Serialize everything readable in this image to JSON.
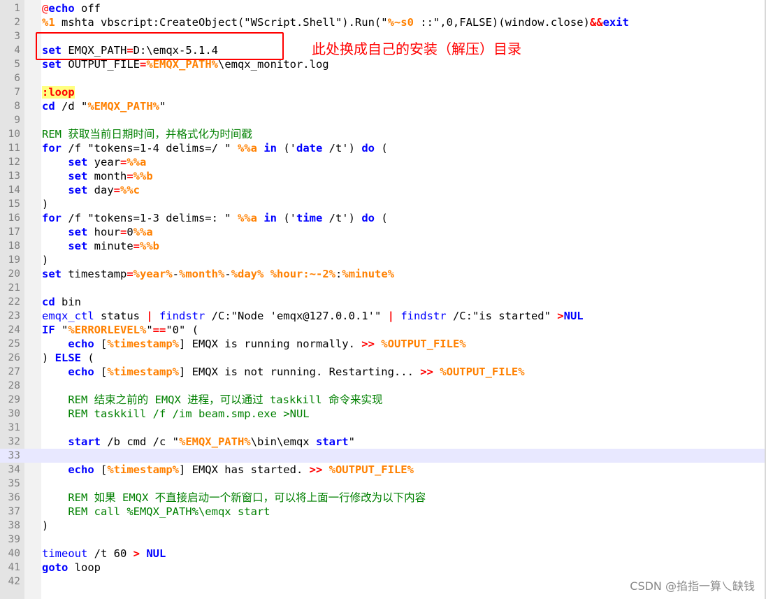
{
  "editor": {
    "current_line": 33,
    "lines": [
      {
        "n": "1",
        "tokens": [
          {
            "t": "@",
            "c": "at"
          },
          {
            "t": "echo",
            "c": "kw"
          },
          {
            "t": " off",
            "c": ""
          }
        ]
      },
      {
        "n": "2",
        "tokens": [
          {
            "t": "%1",
            "c": "var"
          },
          {
            "t": " mshta vbscript:CreateObject(\"WScript.Shell\").Run(\"",
            "c": ""
          },
          {
            "t": "%~s0",
            "c": "var"
          },
          {
            "t": " ::\",0,FALSE)(window.close)",
            "c": ""
          },
          {
            "t": "&&",
            "c": "op"
          },
          {
            "t": "exit",
            "c": "kw"
          }
        ]
      },
      {
        "n": "3",
        "tokens": []
      },
      {
        "n": "4",
        "tokens": [
          {
            "t": "set",
            "c": "kw"
          },
          {
            "t": " EMQX_PATH",
            "c": ""
          },
          {
            "t": "=",
            "c": "op"
          },
          {
            "t": "D:\\emqx-5.1.4",
            "c": ""
          }
        ]
      },
      {
        "n": "5",
        "tokens": [
          {
            "t": "set",
            "c": "kw"
          },
          {
            "t": " OUTPUT_FILE",
            "c": ""
          },
          {
            "t": "=",
            "c": "op"
          },
          {
            "t": "%EMQX_PATH%",
            "c": "var"
          },
          {
            "t": "\\emqx_monitor.log",
            "c": ""
          }
        ]
      },
      {
        "n": "6",
        "tokens": []
      },
      {
        "n": "7",
        "tokens": [
          {
            "t": ":loop",
            "c": "lbl"
          }
        ]
      },
      {
        "n": "8",
        "tokens": [
          {
            "t": "cd",
            "c": "kw"
          },
          {
            "t": " /d \"",
            "c": ""
          },
          {
            "t": "%EMQX_PATH%",
            "c": "var"
          },
          {
            "t": "\"",
            "c": ""
          }
        ]
      },
      {
        "n": "9",
        "tokens": []
      },
      {
        "n": "10",
        "tokens": [
          {
            "t": "REM 获取当前日期时间，并格式化为时间戳",
            "c": "cmt"
          }
        ]
      },
      {
        "n": "11",
        "tokens": [
          {
            "t": "for",
            "c": "kw"
          },
          {
            "t": " /f \"tokens=1-4 delims=/ \" ",
            "c": ""
          },
          {
            "t": "%%a",
            "c": "var"
          },
          {
            "t": " ",
            "c": ""
          },
          {
            "t": "in",
            "c": "kw"
          },
          {
            "t": " ('",
            "c": ""
          },
          {
            "t": "date",
            "c": "kw"
          },
          {
            "t": " /t') ",
            "c": ""
          },
          {
            "t": "do",
            "c": "kw"
          },
          {
            "t": " (",
            "c": ""
          }
        ]
      },
      {
        "n": "12",
        "tokens": [
          {
            "t": "    ",
            "c": ""
          },
          {
            "t": "set",
            "c": "kw"
          },
          {
            "t": " year",
            "c": ""
          },
          {
            "t": "=",
            "c": "op"
          },
          {
            "t": "%%a",
            "c": "var"
          }
        ]
      },
      {
        "n": "13",
        "tokens": [
          {
            "t": "    ",
            "c": ""
          },
          {
            "t": "set",
            "c": "kw"
          },
          {
            "t": " month",
            "c": ""
          },
          {
            "t": "=",
            "c": "op"
          },
          {
            "t": "%%b",
            "c": "var"
          }
        ]
      },
      {
        "n": "14",
        "tokens": [
          {
            "t": "    ",
            "c": ""
          },
          {
            "t": "set",
            "c": "kw"
          },
          {
            "t": " day",
            "c": ""
          },
          {
            "t": "=",
            "c": "op"
          },
          {
            "t": "%%c",
            "c": "var"
          }
        ]
      },
      {
        "n": "15",
        "tokens": [
          {
            "t": ")",
            "c": ""
          }
        ]
      },
      {
        "n": "16",
        "tokens": [
          {
            "t": "for",
            "c": "kw"
          },
          {
            "t": " /f \"tokens=1-3 delims=: \" ",
            "c": ""
          },
          {
            "t": "%%a",
            "c": "var"
          },
          {
            "t": " ",
            "c": ""
          },
          {
            "t": "in",
            "c": "kw"
          },
          {
            "t": " ('",
            "c": ""
          },
          {
            "t": "time",
            "c": "kw"
          },
          {
            "t": " /t') ",
            "c": ""
          },
          {
            "t": "do",
            "c": "kw"
          },
          {
            "t": " (",
            "c": ""
          }
        ]
      },
      {
        "n": "17",
        "tokens": [
          {
            "t": "    ",
            "c": ""
          },
          {
            "t": "set",
            "c": "kw"
          },
          {
            "t": " hour",
            "c": ""
          },
          {
            "t": "=",
            "c": "op"
          },
          {
            "t": "0",
            "c": ""
          },
          {
            "t": "%%a",
            "c": "var"
          }
        ]
      },
      {
        "n": "18",
        "tokens": [
          {
            "t": "    ",
            "c": ""
          },
          {
            "t": "set",
            "c": "kw"
          },
          {
            "t": " minute",
            "c": ""
          },
          {
            "t": "=",
            "c": "op"
          },
          {
            "t": "%%b",
            "c": "var"
          }
        ]
      },
      {
        "n": "19",
        "tokens": [
          {
            "t": ")",
            "c": ""
          }
        ]
      },
      {
        "n": "20",
        "tokens": [
          {
            "t": "set",
            "c": "kw"
          },
          {
            "t": " timestamp",
            "c": ""
          },
          {
            "t": "=",
            "c": "op"
          },
          {
            "t": "%year%",
            "c": "var"
          },
          {
            "t": "-",
            "c": ""
          },
          {
            "t": "%month%",
            "c": "var"
          },
          {
            "t": "-",
            "c": ""
          },
          {
            "t": "%day%",
            "c": "var"
          },
          {
            "t": " ",
            "c": ""
          },
          {
            "t": "%hour:~-2%",
            "c": "var"
          },
          {
            "t": ":",
            "c": ""
          },
          {
            "t": "%minute%",
            "c": "var"
          }
        ]
      },
      {
        "n": "21",
        "tokens": []
      },
      {
        "n": "22",
        "tokens": [
          {
            "t": "cd",
            "c": "kw"
          },
          {
            "t": " bin",
            "c": ""
          }
        ]
      },
      {
        "n": "23",
        "tokens": [
          {
            "t": "emqx_ctl",
            "c": "cmd"
          },
          {
            "t": " status ",
            "c": ""
          },
          {
            "t": "|",
            "c": "op"
          },
          {
            "t": " ",
            "c": ""
          },
          {
            "t": "findstr",
            "c": "cmd"
          },
          {
            "t": " /C:\"Node 'emqx@127.0.0.1'\" ",
            "c": ""
          },
          {
            "t": "|",
            "c": "op"
          },
          {
            "t": " ",
            "c": ""
          },
          {
            "t": "findstr",
            "c": "cmd"
          },
          {
            "t": " /C:\"is started\" ",
            "c": ""
          },
          {
            "t": ">",
            "c": "op"
          },
          {
            "t": "NUL",
            "c": "kw"
          }
        ]
      },
      {
        "n": "24",
        "tokens": [
          {
            "t": "IF",
            "c": "kw"
          },
          {
            "t": " \"",
            "c": ""
          },
          {
            "t": "%ERRORLEVEL%",
            "c": "var"
          },
          {
            "t": "\"",
            "c": ""
          },
          {
            "t": "==",
            "c": "op"
          },
          {
            "t": "\"0\" (",
            "c": ""
          }
        ]
      },
      {
        "n": "25",
        "tokens": [
          {
            "t": "    ",
            "c": ""
          },
          {
            "t": "echo",
            "c": "kw"
          },
          {
            "t": " [",
            "c": ""
          },
          {
            "t": "%timestamp%",
            "c": "var"
          },
          {
            "t": "] EMQX is running normally. ",
            "c": ""
          },
          {
            "t": ">>",
            "c": "op"
          },
          {
            "t": " ",
            "c": ""
          },
          {
            "t": "%OUTPUT_FILE%",
            "c": "var"
          }
        ]
      },
      {
        "n": "26",
        "tokens": [
          {
            "t": ") ",
            "c": ""
          },
          {
            "t": "ELSE",
            "c": "kw"
          },
          {
            "t": " (",
            "c": ""
          }
        ]
      },
      {
        "n": "27",
        "tokens": [
          {
            "t": "    ",
            "c": ""
          },
          {
            "t": "echo",
            "c": "kw"
          },
          {
            "t": " [",
            "c": ""
          },
          {
            "t": "%timestamp%",
            "c": "var"
          },
          {
            "t": "] EMQX is not running. Restarting... ",
            "c": ""
          },
          {
            "t": ">>",
            "c": "op"
          },
          {
            "t": " ",
            "c": ""
          },
          {
            "t": "%OUTPUT_FILE%",
            "c": "var"
          }
        ]
      },
      {
        "n": "28",
        "tokens": []
      },
      {
        "n": "29",
        "tokens": [
          {
            "t": "    REM 结束之前的 EMQX 进程，可以通过 taskkill 命令来实现",
            "c": "cmt"
          }
        ]
      },
      {
        "n": "30",
        "tokens": [
          {
            "t": "    REM taskkill /f /im beam.smp.exe >NUL",
            "c": "cmt"
          }
        ]
      },
      {
        "n": "31",
        "tokens": []
      },
      {
        "n": "32",
        "tokens": [
          {
            "t": "    ",
            "c": ""
          },
          {
            "t": "start",
            "c": "kw"
          },
          {
            "t": " /b cmd /c \"",
            "c": ""
          },
          {
            "t": "%EMQX_PATH%",
            "c": "var"
          },
          {
            "t": "\\bin\\emqx ",
            "c": ""
          },
          {
            "t": "start",
            "c": "kw"
          },
          {
            "t": "\"",
            "c": ""
          }
        ]
      },
      {
        "n": "33",
        "tokens": []
      },
      {
        "n": "34",
        "tokens": [
          {
            "t": "    ",
            "c": ""
          },
          {
            "t": "echo",
            "c": "kw"
          },
          {
            "t": " [",
            "c": ""
          },
          {
            "t": "%timestamp%",
            "c": "var"
          },
          {
            "t": "] EMQX has started. ",
            "c": ""
          },
          {
            "t": ">>",
            "c": "op"
          },
          {
            "t": " ",
            "c": ""
          },
          {
            "t": "%OUTPUT_FILE%",
            "c": "var"
          }
        ]
      },
      {
        "n": "35",
        "tokens": []
      },
      {
        "n": "36",
        "tokens": [
          {
            "t": "    REM 如果 EMQX 不直接启动一个新窗口，可以将上面一行修改为以下内容",
            "c": "cmt"
          }
        ]
      },
      {
        "n": "37",
        "tokens": [
          {
            "t": "    REM call %EMQX_PATH%\\emqx start",
            "c": "cmt"
          }
        ]
      },
      {
        "n": "38",
        "tokens": [
          {
            "t": ")",
            "c": ""
          }
        ]
      },
      {
        "n": "39",
        "tokens": []
      },
      {
        "n": "40",
        "tokens": [
          {
            "t": "timeout",
            "c": "cmd"
          },
          {
            "t": " /t 60 ",
            "c": ""
          },
          {
            "t": ">",
            "c": "op"
          },
          {
            "t": " ",
            "c": ""
          },
          {
            "t": "NUL",
            "c": "kw"
          }
        ]
      },
      {
        "n": "41",
        "tokens": [
          {
            "t": "goto",
            "c": "kw"
          },
          {
            "t": " loop",
            "c": ""
          }
        ]
      },
      {
        "n": "42",
        "tokens": []
      }
    ]
  },
  "annotation": {
    "text": "此处换成自己的安装（解压）目录",
    "color": "#ff0000"
  },
  "watermark": {
    "text": "CSDN @掐指一算乀缺钱"
  },
  "colors": {
    "keyword": "#0000ff",
    "variable": "#ff8000",
    "operator": "#ff0000",
    "comment": "#008000",
    "label_background": "#ffff80",
    "current_line": "#e8e8ff",
    "gutter": "#e4e4e4"
  }
}
